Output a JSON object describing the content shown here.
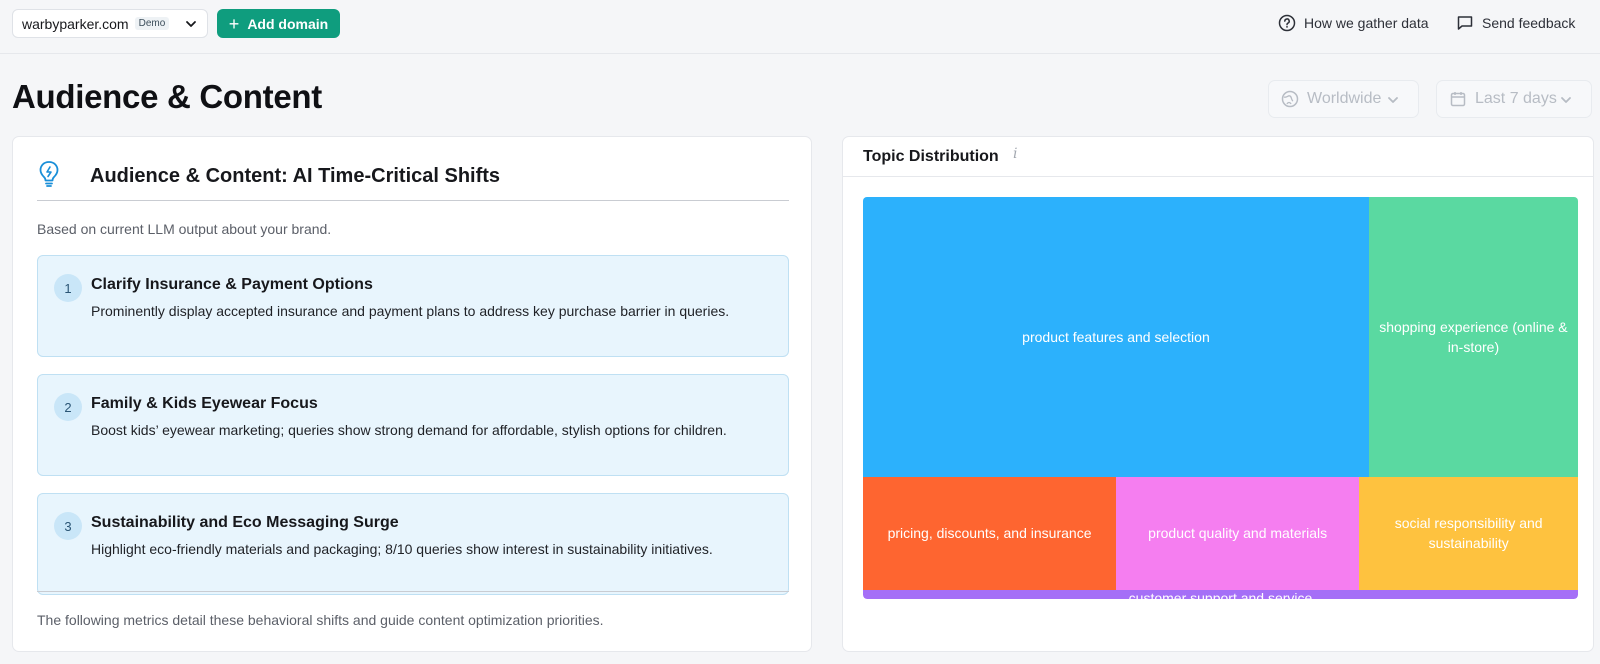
{
  "topbar": {
    "domain": "warbyparker.com",
    "domain_badge": "Demo",
    "add_domain_label": "Add domain",
    "gather_data_label": "How we gather data",
    "feedback_label": "Send feedback"
  },
  "page": {
    "title": "Audience & Content"
  },
  "filters": {
    "region": "Worldwide",
    "period": "Last 7 days"
  },
  "shifts": {
    "title": "Audience & Content: AI Time-Critical Shifts",
    "subtitle": "Based on current LLM output about your brand.",
    "items": [
      {
        "number": "1",
        "title": "Clarify Insurance & Payment Options",
        "description": "Prominently display accepted insurance and payment plans to address key purchase barrier in queries."
      },
      {
        "number": "2",
        "title": "Family & Kids Eyewear Focus",
        "description": "Boost kids’ eyewear marketing; queries show strong demand for affordable, stylish options for children."
      },
      {
        "number": "3",
        "title": "Sustainability and Eco Messaging Surge",
        "description": "Highlight eco-friendly materials and packaging; 8/10 queries show interest in sustainability initiatives."
      }
    ],
    "footer": "The following metrics detail these behavioral shifts and guide content optimization priorities."
  },
  "topic_distribution": {
    "title": "Topic Distribution",
    "info_glyph": "i"
  },
  "chart_data": {
    "type": "treemap",
    "items": [
      {
        "label": "product features and selection",
        "value": 51.3,
        "color": "#2cb1fc"
      },
      {
        "label": "shopping experience (online & in-store)",
        "value": 21.2,
        "color": "#5ad9a1"
      },
      {
        "label": "pricing, discounts, and insurance",
        "value": 10.3,
        "color": "#fe6530"
      },
      {
        "label": "product quality and materials",
        "value": 9.9,
        "color": "#f57ef0"
      },
      {
        "label": "social responsibility and sustainability",
        "value": 8.9,
        "color": "#fec23f"
      },
      {
        "label": "customer support and service",
        "value": 2.4,
        "color": "#a56ff7"
      }
    ]
  }
}
